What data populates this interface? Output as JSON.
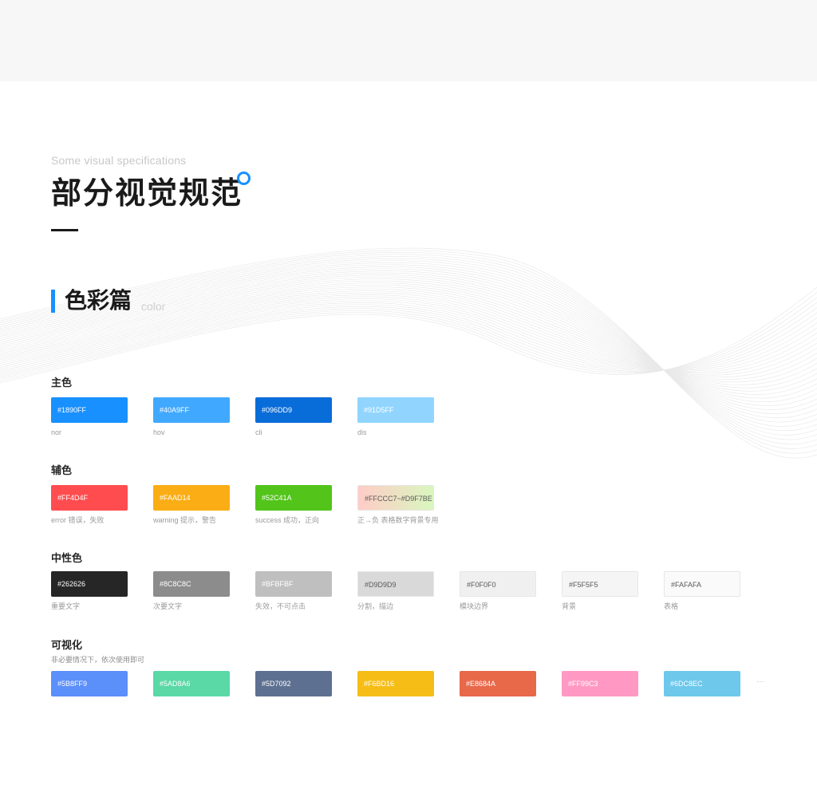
{
  "header": {
    "eyebrow": "Some visual specifications",
    "title": "部分视觉规范"
  },
  "section": {
    "title": "色彩篇",
    "subtitle": "color"
  },
  "colors": {
    "accent": "#1890FF",
    "text": "#262626",
    "top_band": "#F7F7F7"
  },
  "groups": {
    "primary": {
      "title": "主色",
      "swatches": [
        {
          "code": "#1890FF",
          "caption": "nor",
          "color": "#1890FF",
          "text": "#ffffff"
        },
        {
          "code": "#40A9FF",
          "caption": "hov",
          "color": "#40A9FF",
          "text": "#ffffff"
        },
        {
          "code": "#096DD9",
          "caption": "cli",
          "color": "#096DD9",
          "text": "#ffffff"
        },
        {
          "code": "#91D5FF",
          "caption": "dis",
          "color": "#91D5FF",
          "text": "#ffffff"
        }
      ]
    },
    "auxiliary": {
      "title": "辅色",
      "swatches": [
        {
          "code": "#FF4D4F",
          "caption": "error   错误，失败",
          "color": "#FF4D4F",
          "text": "#ffffff"
        },
        {
          "code": "#FAAD14",
          "caption": "warning   提示，警告",
          "color": "#FAAD14",
          "text": "#ffffff"
        },
        {
          "code": "#52C41A",
          "caption": "success   成功，正向",
          "color": "#52C41A",
          "text": "#ffffff"
        },
        {
          "code": "#FFCCC7~#D9F7BE",
          "caption": "正→负   表格数字背景专用",
          "color": "linear-gradient(90deg,#FFCCC7,#D9F7BE)",
          "text": "#595959"
        }
      ]
    },
    "neutral": {
      "title": "中性色",
      "swatches": [
        {
          "code": "#262626",
          "caption": "重要文字",
          "color": "#262626",
          "text": "#ffffff"
        },
        {
          "code": "#8C8C8C",
          "caption": "次要文字",
          "color": "#8C8C8C",
          "text": "#ffffff"
        },
        {
          "code": "#BFBFBF",
          "caption": "失效，不可点击",
          "color": "#BFBFBF",
          "text": "#ffffff"
        },
        {
          "code": "#D9D9D9",
          "caption": "分割，描边",
          "color": "#D9D9D9",
          "text": "#595959"
        },
        {
          "code": "#F0F0F0",
          "caption": "模块边界",
          "color": "#F0F0F0",
          "text": "#595959"
        },
        {
          "code": "#F5F5F5",
          "caption": "背景",
          "color": "#F5F5F5",
          "text": "#595959"
        },
        {
          "code": "#FAFAFA",
          "caption": "表格",
          "color": "#FAFAFA",
          "text": "#595959"
        }
      ]
    },
    "visual": {
      "title": "可视化",
      "note": "非必要情况下，依次使用即可",
      "ellipsis": "···",
      "swatches": [
        {
          "code": "#5B8FF9",
          "color": "#5B8FF9",
          "text": "#ffffff"
        },
        {
          "code": "#5AD8A6",
          "color": "#5AD8A6",
          "text": "#ffffff"
        },
        {
          "code": "#5D7092",
          "color": "#5D7092",
          "text": "#ffffff"
        },
        {
          "code": "#F6BD16",
          "color": "#F6BD16",
          "text": "#ffffff"
        },
        {
          "code": "#E8684A",
          "color": "#E8684A",
          "text": "#ffffff"
        },
        {
          "code": "#FF99C3",
          "color": "#FF99C3",
          "text": "#ffffff"
        },
        {
          "code": "#6DC8EC",
          "color": "#6DC8EC",
          "text": "#ffffff"
        }
      ]
    }
  }
}
